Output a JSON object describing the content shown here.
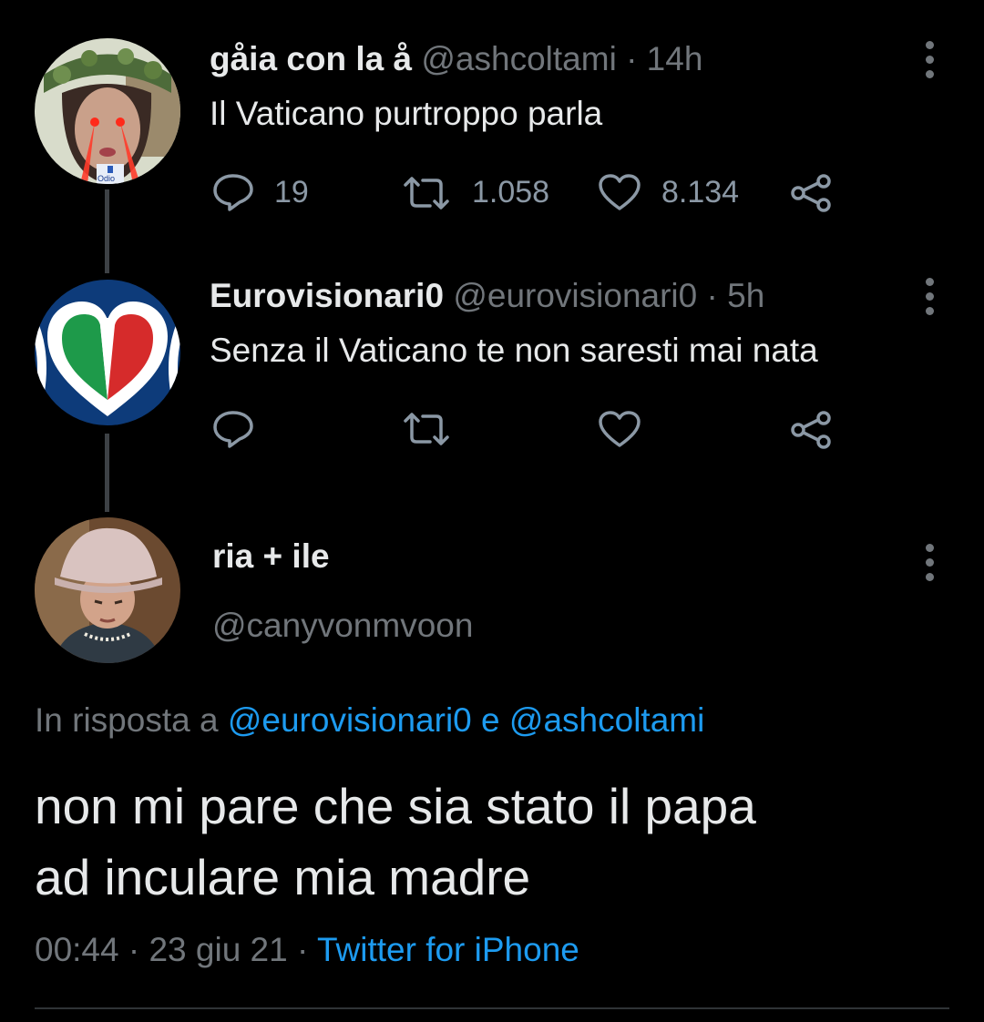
{
  "tweets": [
    {
      "display_name": "gåia con la å",
      "handle": "@ashcoltami",
      "time": "· 14h",
      "text": "Il Vaticano purtroppo parla",
      "avatar_caption": "Odio",
      "replies": "19",
      "retweets": "1.058",
      "likes": "8.134"
    },
    {
      "display_name": "Eurovisionari0",
      "handle": "@eurovisionari0",
      "time": "· 5h",
      "text": "Senza il Vaticano te non saresti mai nata"
    }
  ],
  "main_tweet": {
    "display_name": "ria + ile",
    "handle": "@canyvonmvoon",
    "reply_prefix": "In risposta a",
    "reply_to_1": "@eurovisionari0",
    "reply_joiner": "e",
    "reply_to_2": "@ashcoltami",
    "text_line1": "non mi pare che sia stato il papa",
    "text_line2": "ad inculare mia madre",
    "timestamp": "00:44 · 23 giu 21 ·",
    "source": "Twitter for iPhone"
  },
  "colors": {
    "background": "#000000",
    "text": "#e7e9ea",
    "muted": "#71767b",
    "link": "#1d9bf0"
  },
  "icons": [
    "reply-icon",
    "retweet-icon",
    "like-icon",
    "share-icon",
    "more-options-icon"
  ]
}
